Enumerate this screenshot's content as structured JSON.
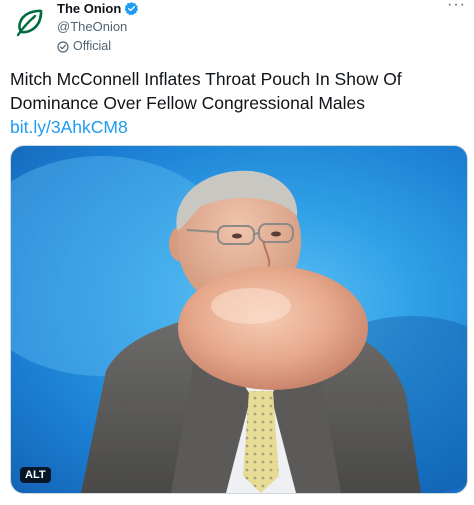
{
  "author": {
    "display_name": "The Onion",
    "handle": "@TheOnion",
    "affiliation_label": "Official",
    "avatar_icon": "onion-logo-icon",
    "verified_icon": "verified-badge-icon",
    "brand_color": "#006B3F"
  },
  "menu": {
    "more_label": "···"
  },
  "tweet": {
    "text": "Mitch McConnell Inflates Throat Pouch In Show Of Dominance Over Fellow Congressional Males",
    "link": "bit.ly/3AhkCM8",
    "link_color": "#1d9bf0"
  },
  "media": {
    "alt_label": "ALT"
  }
}
